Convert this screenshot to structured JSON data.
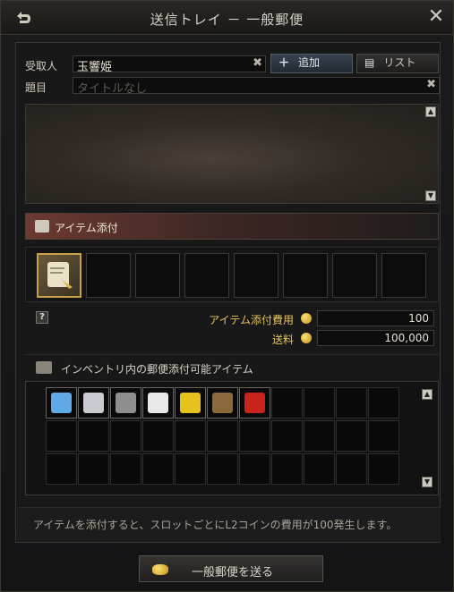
{
  "window": {
    "title": "送信トレイ － 一般郵便"
  },
  "header": {
    "back_icon": "back-arrow-icon",
    "close_icon": "close-icon"
  },
  "recipient": {
    "label": "受取人",
    "value": "玉響姫",
    "add_label": "追加",
    "list_label": "リスト"
  },
  "subject": {
    "label": "題目",
    "placeholder": "タイトルなし"
  },
  "attach": {
    "title": "アイテム添付",
    "cost_label": "アイテム添付費用",
    "cost_value": "100",
    "fee_label": "送料",
    "fee_value": "100,000"
  },
  "inventory": {
    "title": "インベントリ内の郵便添付可能アイテム"
  },
  "notice": {
    "text": "アイテムを添付すると、スロットごとにL2コインの費用が100発生します。"
  },
  "send": {
    "label": "一般郵便を送る"
  },
  "colors": {
    "accent_gold": "#c9a14a",
    "cost_label": "#e6c35a",
    "section_header": "#6c3a31"
  },
  "inventory_items": [
    "magic-staff-icon",
    "armor-piece-icon",
    "hammer-icon",
    "cloak-icon",
    "yellow-cloth-icon",
    "branch-icon",
    "red-potion-icon"
  ]
}
